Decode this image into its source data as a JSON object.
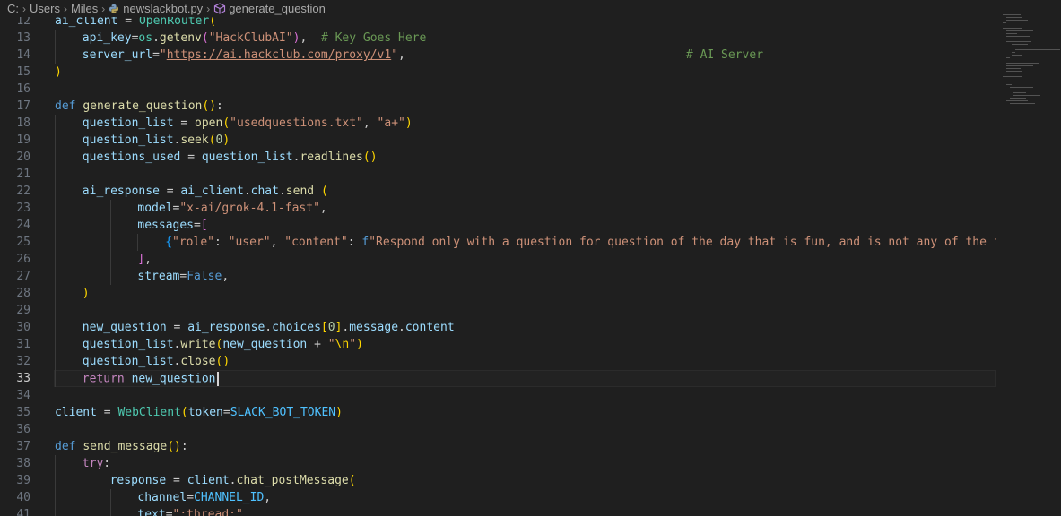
{
  "breadcrumb": {
    "drive": "C:",
    "folder1": "Users",
    "folder2": "Miles",
    "file": "newslackbot.py",
    "symbol": "generate_question"
  },
  "editor": {
    "current_line": "33",
    "lines": [
      {
        "n": "12",
        "indent": 0,
        "tokens": [
          [
            "var",
            "ai_client"
          ],
          [
            "plain",
            " = "
          ],
          [
            "cls",
            "OpenRouter"
          ],
          [
            "p1",
            "("
          ]
        ]
      },
      {
        "n": "13",
        "indent": 1,
        "tokens": [
          [
            "param",
            "api_key"
          ],
          [
            "plain",
            "="
          ],
          [
            "cls",
            "os"
          ],
          [
            "plain",
            "."
          ],
          [
            "fn",
            "getenv"
          ],
          [
            "p2",
            "("
          ],
          [
            "str",
            "\"HackClubAI\""
          ],
          [
            "p2",
            ")"
          ],
          [
            "plain",
            ",  "
          ],
          [
            "com",
            "# Key Goes Here"
          ]
        ]
      },
      {
        "n": "14",
        "indent": 1,
        "tokens": [
          [
            "param",
            "server_url"
          ],
          [
            "plain",
            "="
          ],
          [
            "str",
            "\""
          ],
          [
            "url",
            "https://ai.hackclub.com/proxy/v1"
          ],
          [
            "str",
            "\""
          ],
          [
            "plain",
            ",                                        "
          ],
          [
            "com",
            "# AI Server"
          ]
        ]
      },
      {
        "n": "15",
        "indent": 0,
        "tokens": [
          [
            "p1",
            ")"
          ]
        ]
      },
      {
        "n": "16",
        "indent": 0,
        "tokens": []
      },
      {
        "n": "17",
        "indent": 0,
        "tokens": [
          [
            "def",
            "def "
          ],
          [
            "fn",
            "generate_question"
          ],
          [
            "p1",
            "()"
          ],
          [
            "plain",
            ":"
          ]
        ]
      },
      {
        "n": "18",
        "indent": 1,
        "tokens": [
          [
            "var",
            "question_list"
          ],
          [
            "plain",
            " = "
          ],
          [
            "fn",
            "open"
          ],
          [
            "p1",
            "("
          ],
          [
            "str",
            "\"usedquestions.txt\""
          ],
          [
            "plain",
            ", "
          ],
          [
            "str",
            "\"a+\""
          ],
          [
            "p1",
            ")"
          ]
        ]
      },
      {
        "n": "19",
        "indent": 1,
        "tokens": [
          [
            "var",
            "question_list"
          ],
          [
            "plain",
            "."
          ],
          [
            "fn",
            "seek"
          ],
          [
            "p1",
            "("
          ],
          [
            "num",
            "0"
          ],
          [
            "p1",
            ")"
          ]
        ]
      },
      {
        "n": "20",
        "indent": 1,
        "tokens": [
          [
            "var",
            "questions_used"
          ],
          [
            "plain",
            " = "
          ],
          [
            "var",
            "question_list"
          ],
          [
            "plain",
            "."
          ],
          [
            "fn",
            "readlines"
          ],
          [
            "p1",
            "()"
          ]
        ]
      },
      {
        "n": "21",
        "indent": 1,
        "tokens": []
      },
      {
        "n": "22",
        "indent": 1,
        "tokens": [
          [
            "var",
            "ai_response"
          ],
          [
            "plain",
            " = "
          ],
          [
            "var",
            "ai_client"
          ],
          [
            "plain",
            "."
          ],
          [
            "var",
            "chat"
          ],
          [
            "plain",
            "."
          ],
          [
            "fn",
            "send"
          ],
          [
            "plain",
            " "
          ],
          [
            "p1",
            "("
          ]
        ]
      },
      {
        "n": "23",
        "indent": 3,
        "tokens": [
          [
            "param",
            "model"
          ],
          [
            "plain",
            "="
          ],
          [
            "str",
            "\"x-ai/grok-4.1-fast\""
          ],
          [
            "plain",
            ","
          ]
        ]
      },
      {
        "n": "24",
        "indent": 3,
        "tokens": [
          [
            "param",
            "messages"
          ],
          [
            "plain",
            "="
          ],
          [
            "p2",
            "["
          ]
        ]
      },
      {
        "n": "25",
        "indent": 4,
        "tokens": [
          [
            "p3",
            "{"
          ],
          [
            "str",
            "\"role\""
          ],
          [
            "plain",
            ": "
          ],
          [
            "str",
            "\"user\""
          ],
          [
            "plain",
            ", "
          ],
          [
            "str",
            "\"content\""
          ],
          [
            "plain",
            ": "
          ],
          [
            "def",
            "f"
          ],
          [
            "str",
            "\"Respond only with a question for question of the day that is fun, and is not any of the following: {"
          ]
        ]
      },
      {
        "n": "26",
        "indent": 3,
        "tokens": [
          [
            "p2",
            "]"
          ],
          [
            "plain",
            ","
          ]
        ]
      },
      {
        "n": "27",
        "indent": 3,
        "tokens": [
          [
            "param",
            "stream"
          ],
          [
            "plain",
            "="
          ],
          [
            "bool",
            "False"
          ],
          [
            "plain",
            ","
          ]
        ]
      },
      {
        "n": "28",
        "indent": 1,
        "tokens": [
          [
            "p1",
            ")"
          ]
        ]
      },
      {
        "n": "29",
        "indent": 1,
        "tokens": []
      },
      {
        "n": "30",
        "indent": 1,
        "tokens": [
          [
            "var",
            "new_question"
          ],
          [
            "plain",
            " = "
          ],
          [
            "var",
            "ai_response"
          ],
          [
            "plain",
            "."
          ],
          [
            "var",
            "choices"
          ],
          [
            "p1",
            "["
          ],
          [
            "num",
            "0"
          ],
          [
            "p1",
            "]"
          ],
          [
            "plain",
            "."
          ],
          [
            "var",
            "message"
          ],
          [
            "plain",
            "."
          ],
          [
            "var",
            "content"
          ]
        ]
      },
      {
        "n": "31",
        "indent": 1,
        "tokens": [
          [
            "var",
            "question_list"
          ],
          [
            "plain",
            "."
          ],
          [
            "fn",
            "write"
          ],
          [
            "p1",
            "("
          ],
          [
            "var",
            "new_question"
          ],
          [
            "plain",
            " + "
          ],
          [
            "str",
            "\""
          ],
          [
            "p1",
            "\\n"
          ],
          [
            "str",
            "\""
          ],
          [
            "p1",
            ")"
          ]
        ]
      },
      {
        "n": "32",
        "indent": 1,
        "tokens": [
          [
            "var",
            "question_list"
          ],
          [
            "plain",
            "."
          ],
          [
            "fn",
            "close"
          ],
          [
            "p1",
            "()"
          ]
        ]
      },
      {
        "n": "33",
        "indent": 1,
        "tokens": [
          [
            "kwctl",
            "return"
          ],
          [
            "plain",
            " "
          ],
          [
            "var",
            "new_question"
          ]
        ]
      },
      {
        "n": "34",
        "indent": 0,
        "tokens": []
      },
      {
        "n": "35",
        "indent": 0,
        "tokens": [
          [
            "var",
            "client"
          ],
          [
            "plain",
            " = "
          ],
          [
            "cls",
            "WebClient"
          ],
          [
            "p1",
            "("
          ],
          [
            "param",
            "token"
          ],
          [
            "plain",
            "="
          ],
          [
            "const",
            "SLACK_BOT_TOKEN"
          ],
          [
            "p1",
            ")"
          ]
        ]
      },
      {
        "n": "36",
        "indent": 0,
        "tokens": []
      },
      {
        "n": "37",
        "indent": 0,
        "tokens": [
          [
            "def",
            "def "
          ],
          [
            "fn",
            "send_message"
          ],
          [
            "p1",
            "()"
          ],
          [
            "plain",
            ":"
          ]
        ]
      },
      {
        "n": "38",
        "indent": 1,
        "tokens": [
          [
            "kwctl",
            "try"
          ],
          [
            "plain",
            ":"
          ]
        ]
      },
      {
        "n": "39",
        "indent": 2,
        "tokens": [
          [
            "var",
            "response"
          ],
          [
            "plain",
            " = "
          ],
          [
            "var",
            "client"
          ],
          [
            "plain",
            "."
          ],
          [
            "fn",
            "chat_postMessage"
          ],
          [
            "p1",
            "("
          ]
        ]
      },
      {
        "n": "40",
        "indent": 3,
        "tokens": [
          [
            "param",
            "channel"
          ],
          [
            "plain",
            "="
          ],
          [
            "const",
            "CHANNEL_ID"
          ],
          [
            "plain",
            ","
          ]
        ]
      },
      {
        "n": "41",
        "indent": 3,
        "tokens": [
          [
            "param",
            "text"
          ],
          [
            "plain",
            "="
          ],
          [
            "str",
            "\":thread:\""
          ]
        ]
      }
    ]
  },
  "colors": {
    "background": "#1f1f1f",
    "line_number": "#6e7681",
    "keyword": "#c586c0",
    "function": "#dcdcaa",
    "variable": "#9cdcfe",
    "class": "#4ec9b0",
    "string": "#ce9178",
    "comment": "#6a9955"
  }
}
